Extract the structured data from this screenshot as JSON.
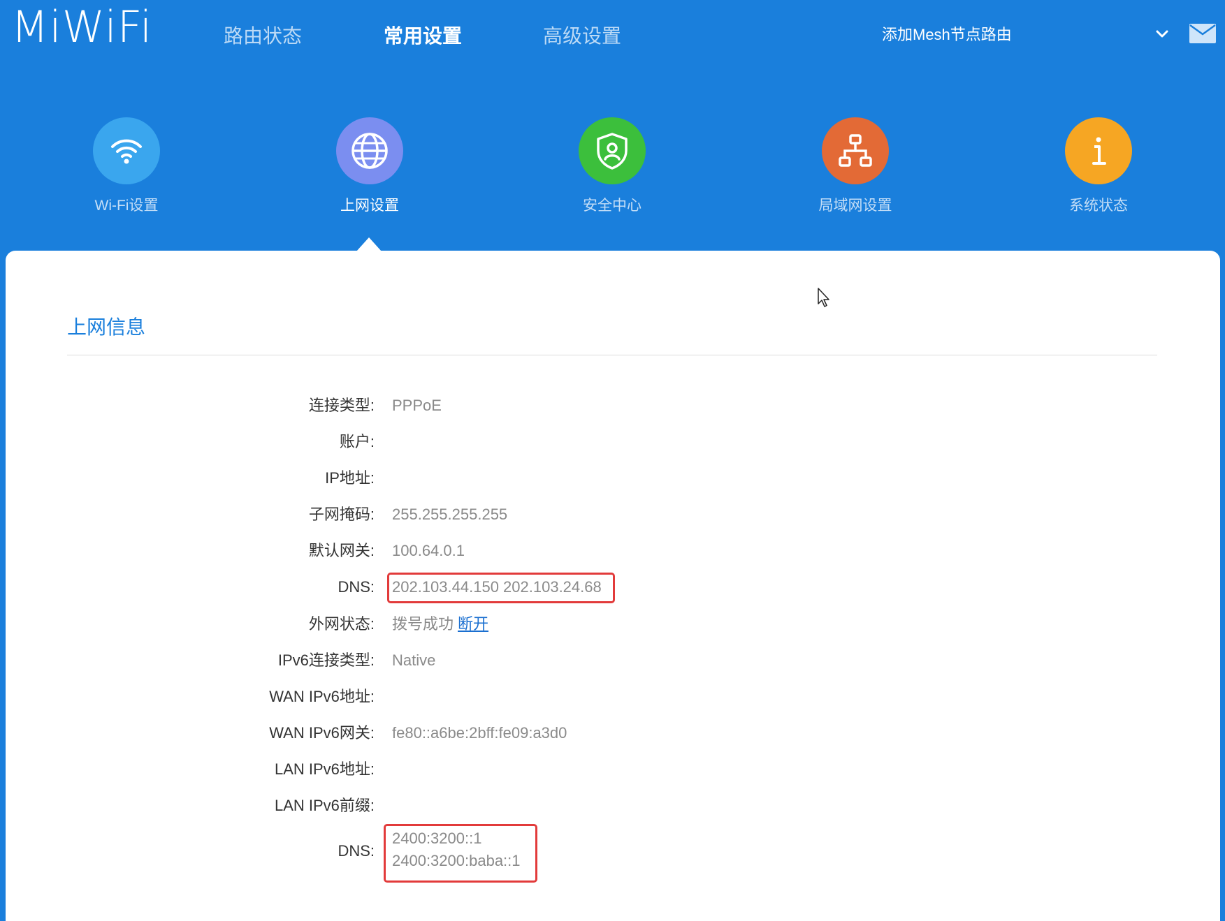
{
  "header": {
    "logo": "MiWiFi",
    "nav": [
      {
        "label": "路由状态",
        "active": false
      },
      {
        "label": "常用设置",
        "active": true
      },
      {
        "label": "高级设置",
        "active": false
      }
    ],
    "mesh_link": "添加Mesh节点路由"
  },
  "categories": [
    {
      "label": "Wi-Fi设置",
      "icon": "wifi-icon",
      "color": "#3aa6ee"
    },
    {
      "label": "上网设置",
      "icon": "globe-icon",
      "color": "#7b8ef0",
      "active": true
    },
    {
      "label": "安全中心",
      "icon": "shield-icon",
      "color": "#3cbf3c"
    },
    {
      "label": "局域网设置",
      "icon": "lan-icon",
      "color": "#e36a36"
    },
    {
      "label": "系统状态",
      "icon": "info-icon",
      "color": "#f6a623"
    }
  ],
  "main": {
    "title": "上网信息",
    "rows": [
      {
        "label": "连接类型:",
        "value": "PPPoE"
      },
      {
        "label": "账户:",
        "value": ""
      },
      {
        "label": "IP地址:",
        "value": ""
      },
      {
        "label": "子网掩码:",
        "value": "255.255.255.255"
      },
      {
        "label": "默认网关:",
        "value": "100.64.0.1"
      },
      {
        "label": "DNS:",
        "value": "202.103.44.150 202.103.24.68"
      },
      {
        "label": "外网状态:",
        "value": "拨号成功",
        "link": "断开"
      },
      {
        "label": "IPv6连接类型:",
        "value": "Native"
      },
      {
        "label": "WAN IPv6地址:",
        "value": ""
      },
      {
        "label": "WAN IPv6网关:",
        "value": "fe80::a6be:2bff:fe09:a3d0"
      },
      {
        "label": "LAN IPv6地址:",
        "value": ""
      },
      {
        "label": "LAN IPv6前缀:",
        "value": ""
      }
    ],
    "dns6": {
      "label": "DNS:",
      "values": [
        "2400:3200::1",
        "2400:3200:baba::1"
      ]
    },
    "highlight_color": "#e23b3b"
  }
}
